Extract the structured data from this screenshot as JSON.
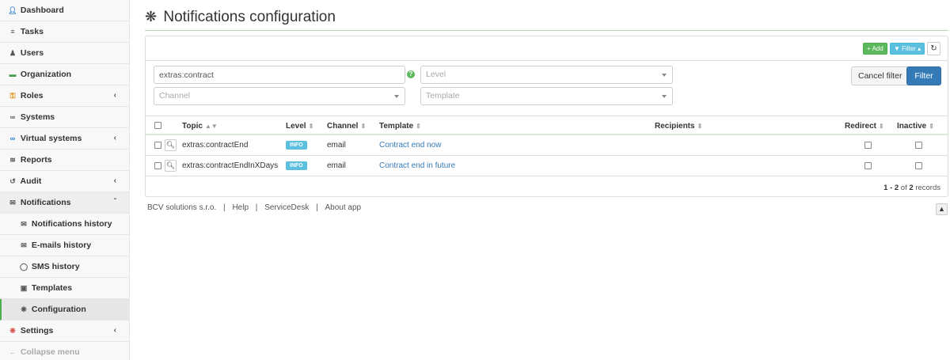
{
  "sidebar": {
    "items": [
      {
        "label": "Dashboard",
        "icon": "user-icon"
      },
      {
        "label": "Tasks",
        "icon": "list-icon"
      },
      {
        "label": "Users",
        "icon": "users-icon"
      },
      {
        "label": "Organization",
        "icon": "folder-icon"
      },
      {
        "label": "Roles",
        "icon": "key-icon"
      },
      {
        "label": "Systems",
        "icon": "link-icon"
      },
      {
        "label": "Virtual systems",
        "icon": "link-icon"
      },
      {
        "label": "Reports",
        "icon": "chart-icon"
      },
      {
        "label": "Audit",
        "icon": "history-icon"
      },
      {
        "label": "Notifications",
        "icon": "envelope-icon"
      },
      {
        "label": "Notifications history",
        "icon": "envelope-icon"
      },
      {
        "label": "E-mails history",
        "icon": "envelope-open-icon"
      },
      {
        "label": "SMS history",
        "icon": "comment-icon"
      },
      {
        "label": "Templates",
        "icon": "template-icon"
      },
      {
        "label": "Configuration",
        "icon": "gear-icon"
      },
      {
        "label": "Settings",
        "icon": "gear-icon"
      },
      {
        "label": "Collapse menu",
        "icon": "arrow-left-icon"
      }
    ]
  },
  "page": {
    "title": "Notifications configuration"
  },
  "toolbar": {
    "add_label": "+ Add",
    "filter_toggle_label": "Filter",
    "refresh_icon": "refresh-icon"
  },
  "filter": {
    "text_value": "extras:contract",
    "level_placeholder": "Level",
    "channel_placeholder": "Channel",
    "template_placeholder": "Template",
    "cancel_label": "Cancel filter",
    "filter_label": "Filter"
  },
  "table": {
    "columns": [
      "Topic",
      "Level",
      "Channel",
      "Template",
      "Recipients",
      "Redirect",
      "Inactive"
    ],
    "rows": [
      {
        "topic": "extras:contractEnd",
        "level": "INFO",
        "channel": "email",
        "template": "Contract end now",
        "recipients": "",
        "redirect": false,
        "inactive": false
      },
      {
        "topic": "extras:contractEndInXDays",
        "level": "INFO",
        "channel": "email",
        "template": "Contract end in future",
        "recipients": "",
        "redirect": false,
        "inactive": false
      }
    ]
  },
  "pagination": {
    "range": "1 - 2",
    "of": "of",
    "total": "2",
    "records": "records"
  },
  "footer": {
    "company": "BCV solutions s.r.o.",
    "sep": "|",
    "help": "Help",
    "servicedesk": "ServiceDesk",
    "about": "About app"
  },
  "colors": {
    "primary": "#337ab7",
    "success": "#5cb85c",
    "info": "#5bc0de"
  }
}
